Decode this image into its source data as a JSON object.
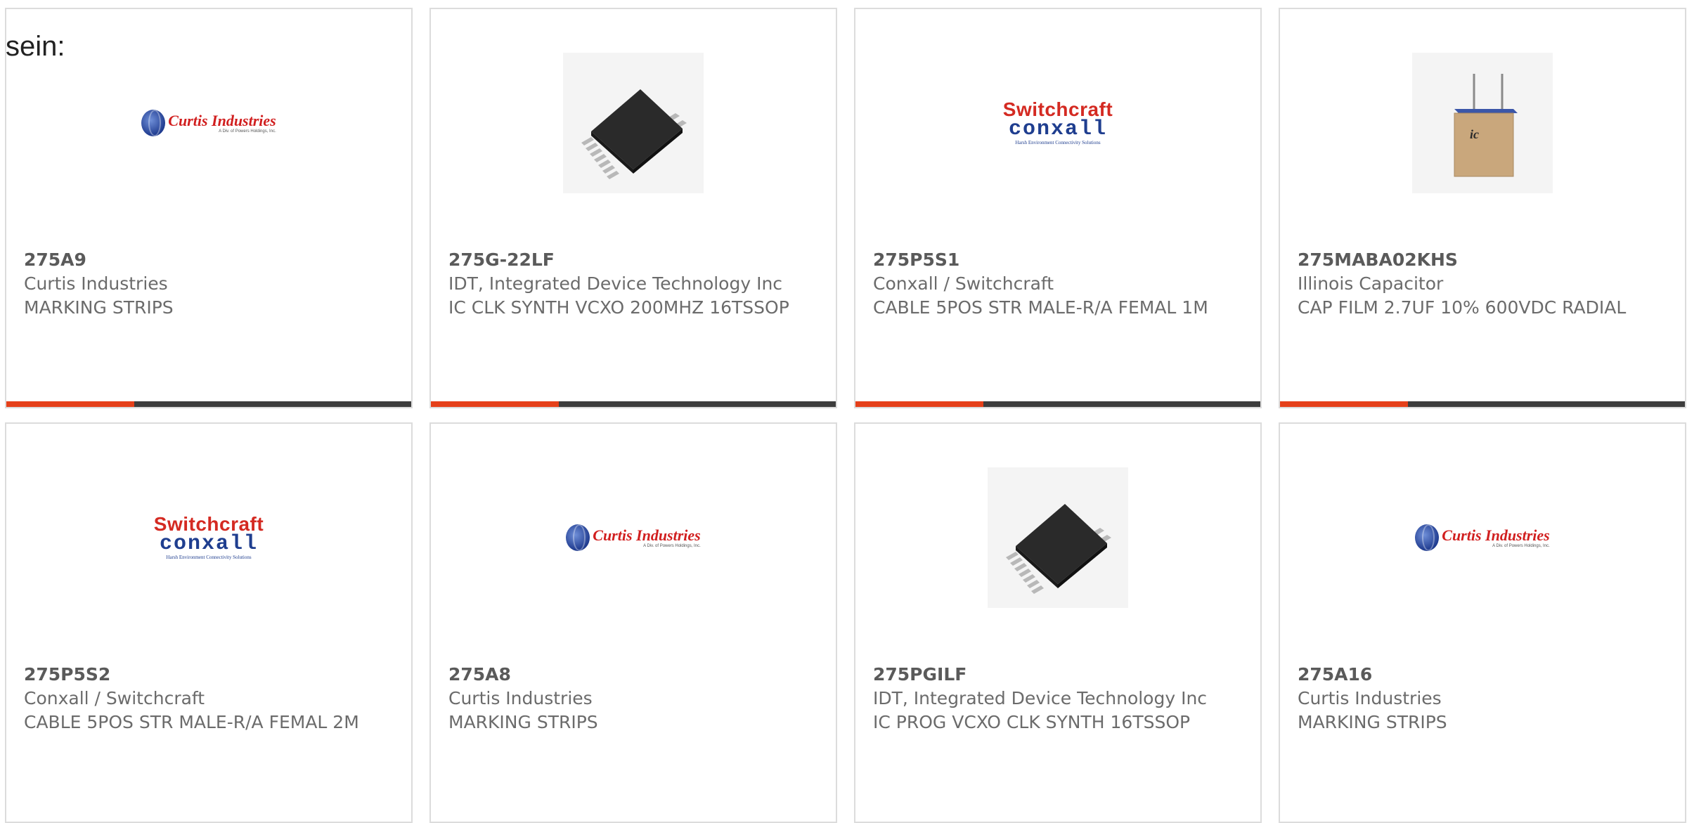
{
  "page": {
    "label": "sein:"
  },
  "products": [
    {
      "part_number": "275A9",
      "manufacturer": "Curtis Industries",
      "description": "MARKING STRIPS",
      "image": "curtis-logo"
    },
    {
      "part_number": "275G-22LF",
      "manufacturer": "IDT, Integrated Device Technology Inc",
      "description": "IC CLK SYNTH VCXO 200MHZ 16TSSOP",
      "image": "tssop-chip"
    },
    {
      "part_number": "275P5S1",
      "manufacturer": "Conxall / Switchcraft",
      "description": "CABLE 5POS STR MALE-R/A FEMAL 1M",
      "image": "switchcraft-logo"
    },
    {
      "part_number": "275MABA02KHS",
      "manufacturer": "Illinois Capacitor",
      "description": "CAP FILM 2.7UF 10% 600VDC RADIAL",
      "image": "film-capacitor"
    },
    {
      "part_number": "275P5S2",
      "manufacturer": "Conxall / Switchcraft",
      "description": "CABLE 5POS STR MALE-R/A FEMAL 2M",
      "image": "switchcraft-logo"
    },
    {
      "part_number": "275A8",
      "manufacturer": "Curtis Industries",
      "description": "MARKING STRIPS",
      "image": "curtis-logo"
    },
    {
      "part_number": "275PGILF",
      "manufacturer": "IDT, Integrated Device Technology Inc",
      "description": "IC PROG VCXO CLK SYNTH 16TSSOP",
      "image": "tssop-chip"
    },
    {
      "part_number": "275A16",
      "manufacturer": "Curtis Industries",
      "description": "MARKING STRIPS",
      "image": "curtis-logo"
    }
  ],
  "logos": {
    "curtis": {
      "name": "Curtis Industries",
      "sub": "A Div. of Powers Holdings, Inc."
    },
    "switchcraft": {
      "top": "Switchcraft",
      "bottom": "conxall",
      "tagline": "Harsh Environment Connectivity Solutions"
    },
    "capacitor_mark": "ic"
  },
  "colors": {
    "accent": "#e5401a",
    "bar": "#3d3d3d",
    "border": "#dcdcdc",
    "text": "#6b6b6b",
    "curtis_red": "#d11f1f",
    "conxall_blue": "#1f3e8f"
  }
}
